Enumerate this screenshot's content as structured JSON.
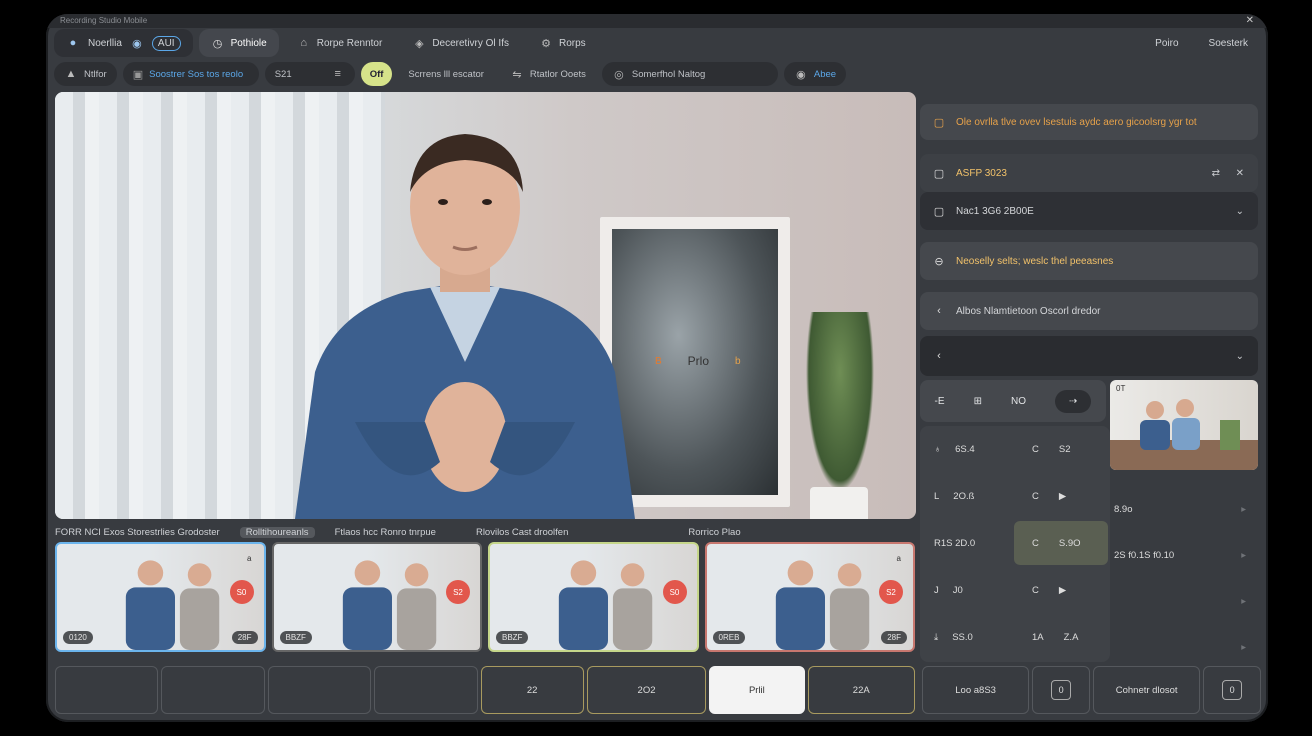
{
  "window": {
    "title": "Recording Studio Mobile"
  },
  "topbar": {
    "brand_label": "Noerllia",
    "ai_label": "AUI",
    "tabs": [
      {
        "label": "Pothiole"
      },
      {
        "label": "Rorpe Renntor"
      },
      {
        "label": "Deceretivry Ol Ifs"
      },
      {
        "label": "Rorps"
      }
    ],
    "right": {
      "label1": "Poiro",
      "label2": "Soesterk"
    }
  },
  "subbar": {
    "home": "Ntlfor",
    "source": "Soostrer Sos tos reolo",
    "counter": "S21",
    "tag": "Off",
    "stream": "Scrrens lll escator",
    "cam": "Rtatlor Ooets",
    "aux": "Somerfhol Naltog",
    "end": "Abee"
  },
  "main": {
    "overlay_label": "Prlo",
    "overlay_left": "B",
    "overlay_right": "b"
  },
  "right_panel": {
    "notice": "Ole ovrlla tlve ovev lsestuis aydc aero gicoolsrg ygr tot",
    "aspect": {
      "label": "ASFP 3023"
    },
    "resolution": {
      "label": "Nac1 3G6 2B00E"
    },
    "message": "Neoselly selts; weslc thel peeasnes",
    "add_info": "Albos Nlamtietoon Oscorl dredor",
    "tools": [
      "-E",
      "⊞",
      "NO",
      "⇢"
    ],
    "thumb_label": "0T",
    "grid": [
      {
        "c1": "6S.4",
        "c2a": "C",
        "c2b": "S2"
      },
      {
        "c1": "2O.ß",
        "c2a": "C",
        "c2b": "▶"
      },
      {
        "c1": "R1S 2D.0",
        "c2a": "C",
        "c2b": "S.9O"
      },
      {
        "c1": "J0",
        "c2a": "C",
        "c2b": "▶"
      },
      {
        "c1": "SS.0",
        "c2a": "1A",
        "c2b": "Z.A"
      }
    ],
    "side": [
      {
        "label": "8.9o"
      },
      {
        "label": "2S f0.1S f0.10"
      },
      {
        "label": ""
      },
      {
        "label": ""
      }
    ]
  },
  "strip": {
    "labels": [
      "FORR NCI Exos Storestrlies Grodoster",
      "Rolltihoureanls",
      "Ftlaos hcc Ronro tnrpue",
      "Rlovilos Cast droolfen",
      "Rorrico Plao"
    ],
    "thumbs": [
      {
        "badge": "a",
        "rec": "S0",
        "cap1": "0120",
        "cap2": "28F"
      },
      {
        "badge": "",
        "rec": "S2",
        "cap1": "BBZF",
        "cap2": ""
      },
      {
        "badge": "",
        "rec": "S0",
        "cap1": "BBZF",
        "cap2": ""
      },
      {
        "badge": "a",
        "rec": "S2",
        "cap1": "0REB",
        "cap2": "28F"
      }
    ]
  },
  "bottom": {
    "b1": "",
    "b2": "",
    "b3": "",
    "b4": "",
    "b5": "22",
    "b6": "2O2",
    "b7": "Prlil",
    "b8": "22A",
    "b9": "Loo a8S3",
    "b10": "0",
    "b11": "Cohnetr dlosot",
    "b12": "0"
  },
  "colors": {
    "accent_blue": "#6bb4ec",
    "accent_green": "#d6e38a",
    "record_red": "#e2574c",
    "amber": "#e7a24a"
  }
}
